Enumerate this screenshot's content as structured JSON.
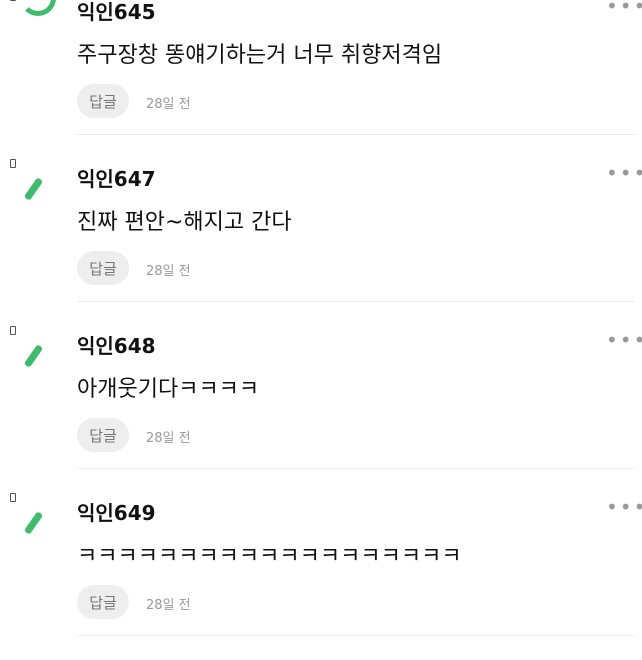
{
  "comments": [
    {
      "nickname": "익인645",
      "text": "주구장창 똥얘기하는거 너무 취향저격임",
      "reply_label": "답글",
      "time": "28일 전",
      "more": "•••"
    },
    {
      "nickname": "익인647",
      "text": "진짜 편안~해지고 간다",
      "reply_label": "답글",
      "time": "28일 전",
      "more": "•••"
    },
    {
      "nickname": "익인648",
      "text": "아개웃기다ㅋㅋㅋㅋ",
      "reply_label": "답글",
      "time": "28일 전",
      "more": "•••"
    },
    {
      "nickname": "익인649",
      "text": "ㅋㅋㅋㅋㅋㅋㅋㅋㅋㅋㅋㅋㅋㅋㅋㅋㅋㅋㅋ",
      "reply_label": "답글",
      "time": "28일 전",
      "more": "•••"
    }
  ],
  "colors": {
    "accent": "#3dbd6c",
    "muted": "#9a9a9a",
    "pill": "#eeeeee"
  }
}
